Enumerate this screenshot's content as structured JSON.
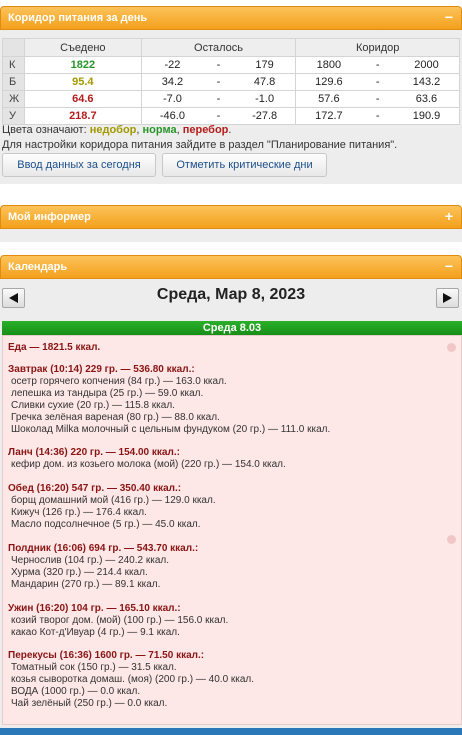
{
  "corridor": {
    "title": "Коридор питания за день",
    "toggle": "−",
    "headers": {
      "eaten": "Съедено",
      "left": "Осталось",
      "corridor": "Коридор"
    },
    "rows": [
      {
        "label": "К",
        "eaten": "1822",
        "left_from": "-22",
        "left_dash": "-",
        "left_to": "179",
        "cor_from": "1800",
        "cor_dash": "-",
        "cor_to": "2000"
      },
      {
        "label": "Б",
        "eaten": "95.4",
        "left_from": "34.2",
        "left_dash": "-",
        "left_to": "47.8",
        "cor_from": "129.6",
        "cor_dash": "-",
        "cor_to": "143.2"
      },
      {
        "label": "Ж",
        "eaten": "64.6",
        "left_from": "-7.0",
        "left_dash": "-",
        "left_to": "-1.0",
        "cor_from": "57.6",
        "cor_dash": "-",
        "cor_to": "63.6"
      },
      {
        "label": "У",
        "eaten": "218.7",
        "left_from": "-46.0",
        "left_dash": "-",
        "left_to": "-27.8",
        "cor_from": "172.7",
        "cor_dash": "-",
        "cor_to": "190.9"
      }
    ],
    "legend_prefix": "Цвета означают:",
    "legend_under": "недобор",
    "legend_sep1": ",",
    "legend_norm": "норма",
    "legend_sep2": ",",
    "legend_over": "перебор",
    "legend_end": ".",
    "settings_hint": "Для настройки коридора питания зайдите в раздел \"Планирование питания\".",
    "btn_enter": "Ввод данных за сегодня",
    "btn_critical": "Отметить критические дни",
    "colors": {
      "under": "#a39a00",
      "norm": "#27962a",
      "over": "#b61b1b"
    }
  },
  "informer": {
    "title": "Мой информер",
    "toggle": "+"
  },
  "calendar": {
    "title": "Календарь",
    "toggle": "−",
    "date_title": "Среда, Мар 8, 2023",
    "day_label": "Среда 8.03",
    "food_total": "Еда — 1821.5 ккал.",
    "meals": [
      {
        "header": "Завтрак (10:14) 229 гр. — 536.80 ккал.:",
        "items": [
          "осетр горячего копчения (84 гр.) — 163.0 ккал.",
          "лепешка из тандыра (25 гр.) — 59.0 ккал.",
          "Сливки сухие (20 гр.) — 115.8 ккал.",
          "Гречка зелёная вареная (80 гр.) — 88.0 ккал.",
          "Шоколад Milka молочный с цельным фундуком (20 гр.) — 111.0 ккал."
        ]
      },
      {
        "header": "Ланч (14:36) 220 гр. — 154.00 ккал.:",
        "items": [
          "кефир дом. из козьего молока (мой) (220 гр.) — 154.0 ккал."
        ]
      },
      {
        "header": "Обед (16:20) 547 гр. — 350.40 ккал.:",
        "items": [
          "борщ домашний мой (416 гр.) — 129.0 ккал.",
          "Кижуч (126 гр.) — 176.4 ккал.",
          "Масло подсолнечное (5 гр.) — 45.0 ккал."
        ]
      },
      {
        "header": "Полдник (16:06) 694 гр. — 543.70 ккал.:",
        "items": [
          "Чернослив (104 гр.) — 240.2 ккал.",
          "Хурма (320 гр.) — 214.4 ккал.",
          "Мандарин (270 гр.) — 89.1 ккал."
        ]
      },
      {
        "header": "Ужин (16:20) 104 гр. — 165.10 ккал.:",
        "items": [
          "козий творог дом. (мой) (100 гр.) — 156.0 ккал.",
          "какао Кот-д'Ивуар (4 гр.) — 9.1 ккал."
        ]
      },
      {
        "header": "Перекусы (16:36) 1600 гр. — 71.50 ккал.:",
        "items": [
          "Томатный сок (150 гр.) — 31.5 ккал.",
          "козья сыворотка домаш. (моя) (200 гр.) — 40.0 ккал.",
          "ВОДА (1000 гр.) — 0.0 ккал.",
          "Чай зелёный (250 гр.) — 0.0 ккал."
        ]
      }
    ]
  }
}
